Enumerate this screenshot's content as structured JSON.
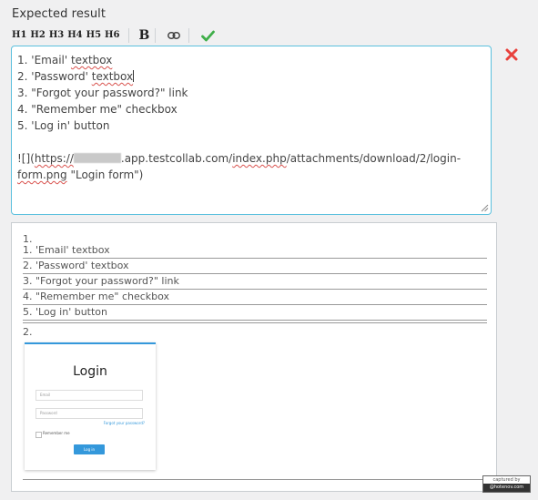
{
  "section": {
    "title": "Expected result"
  },
  "toolbar": {
    "headings": [
      "H1",
      "H2",
      "H3",
      "H4",
      "H5",
      "H6"
    ],
    "bold_label": "B"
  },
  "editor": {
    "lines": [
      "1. 'Email' ",
      "textbox",
      "2. 'Password' ",
      "textbox",
      "3. \"Forgot your password?\" link",
      "4. \"Remember me\" checkbox",
      "5. 'Log in' button",
      "![](",
      "https://",
      ".app.testcollab.com/",
      "index.php",
      "/attachments/download/2/login-",
      "form.png",
      " \"Login form\")"
    ]
  },
  "preview": {
    "outer_num_1": "1.",
    "outer_num_2": "2.",
    "items": [
      "1. 'Email' textbox",
      "2. 'Password' textbox",
      "3. \"Forgot your password?\" link",
      "4. \"Remember me\" checkbox",
      "5. 'Log in' button"
    ],
    "image": {
      "title": "Login",
      "email_placeholder": "Email",
      "password_placeholder": "Password",
      "forgot_link": "Forgot your password?",
      "remember_label": "Remember me",
      "button_label": "Log in"
    }
  },
  "watermark": {
    "line1": "captured by",
    "line2": "@hotenov.com"
  },
  "colors": {
    "editor_border": "#5bc0de",
    "remove_icon": "#e8413c",
    "check_icon": "#3fae49",
    "image_accent": "#3498db"
  },
  "icons": {
    "link": "link-icon",
    "accept": "check-icon",
    "remove": "close-icon"
  }
}
